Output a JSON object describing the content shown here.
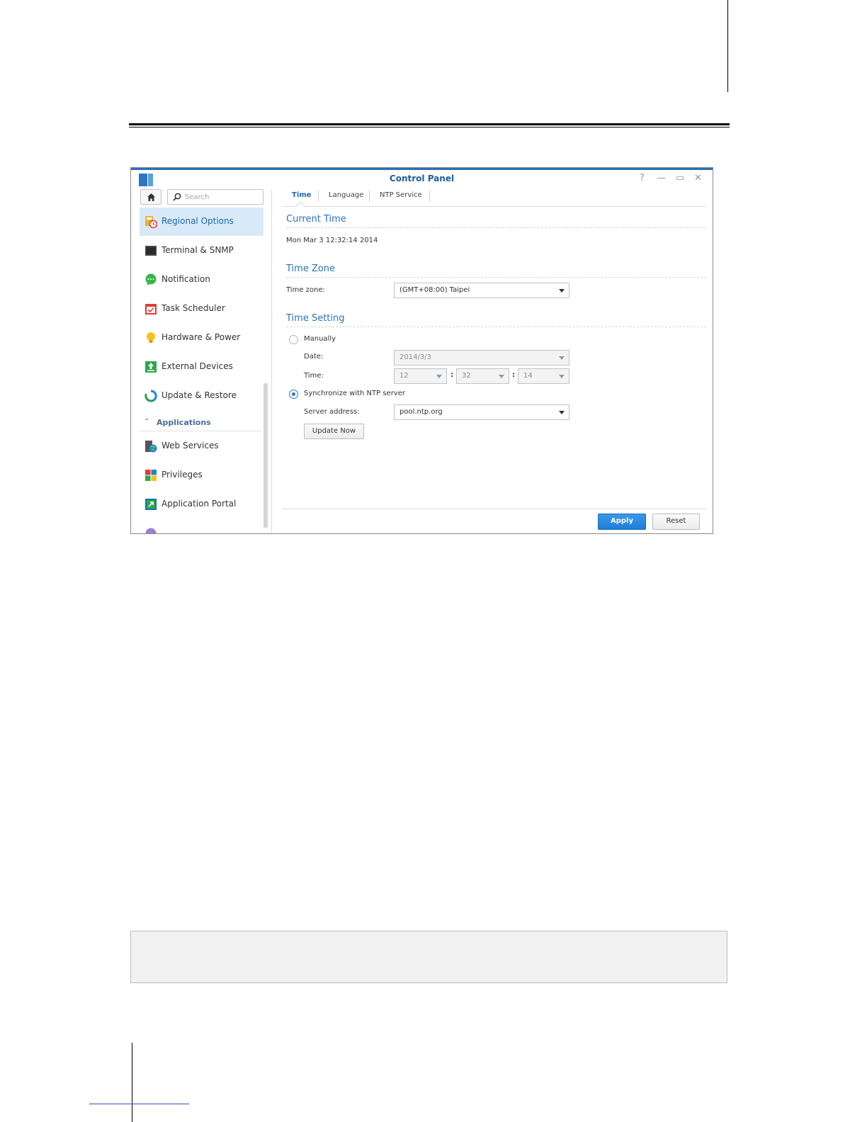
{
  "window": {
    "title": "Control Panel",
    "controls": {
      "help": "?",
      "minimize": "—",
      "maximize": "▭",
      "close": "✕"
    }
  },
  "search": {
    "placeholder": "Search"
  },
  "sidebar": {
    "items": [
      {
        "label": "Regional Options",
        "icon": "regional-options-icon",
        "active": true
      },
      {
        "label": "Terminal & SNMP",
        "icon": "terminal-icon"
      },
      {
        "label": "Notification",
        "icon": "notification-icon"
      },
      {
        "label": "Task Scheduler",
        "icon": "task-scheduler-icon"
      },
      {
        "label": "Hardware & Power",
        "icon": "hardware-power-icon"
      },
      {
        "label": "External Devices",
        "icon": "external-devices-icon"
      },
      {
        "label": "Update & Restore",
        "icon": "update-restore-icon"
      }
    ],
    "section": {
      "label": "Applications"
    },
    "app_items": [
      {
        "label": "Web Services",
        "icon": "web-services-icon"
      },
      {
        "label": "Privileges",
        "icon": "privileges-icon"
      },
      {
        "label": "Application Portal",
        "icon": "application-portal-icon"
      }
    ]
  },
  "tabs": [
    {
      "label": "Time",
      "active": true
    },
    {
      "label": "Language"
    },
    {
      "label": "NTP Service"
    }
  ],
  "current_time": {
    "title": "Current Time",
    "value": "Mon Mar 3 12:32:14 2014"
  },
  "time_zone": {
    "title": "Time Zone",
    "label": "Time zone:",
    "value": "(GMT+08:00) Taipei"
  },
  "time_setting": {
    "title": "Time Setting",
    "manually_label": "Manually",
    "date_label": "Date:",
    "date_value": "2014/3/3",
    "time_label": "Time:",
    "hour": "12",
    "minute": "32",
    "second": "14",
    "separator": ":",
    "ntp_label": "Synchronize with NTP server",
    "server_label": "Server address:",
    "server_value": "pool.ntp.org",
    "update_now": "Update Now",
    "selected_mode": "ntp"
  },
  "footer": {
    "apply": "Apply",
    "reset": "Reset"
  },
  "colors": {
    "accent": "#2a72bd",
    "active_bg": "#d8eaf8",
    "primary_button": "#2a86dc"
  }
}
